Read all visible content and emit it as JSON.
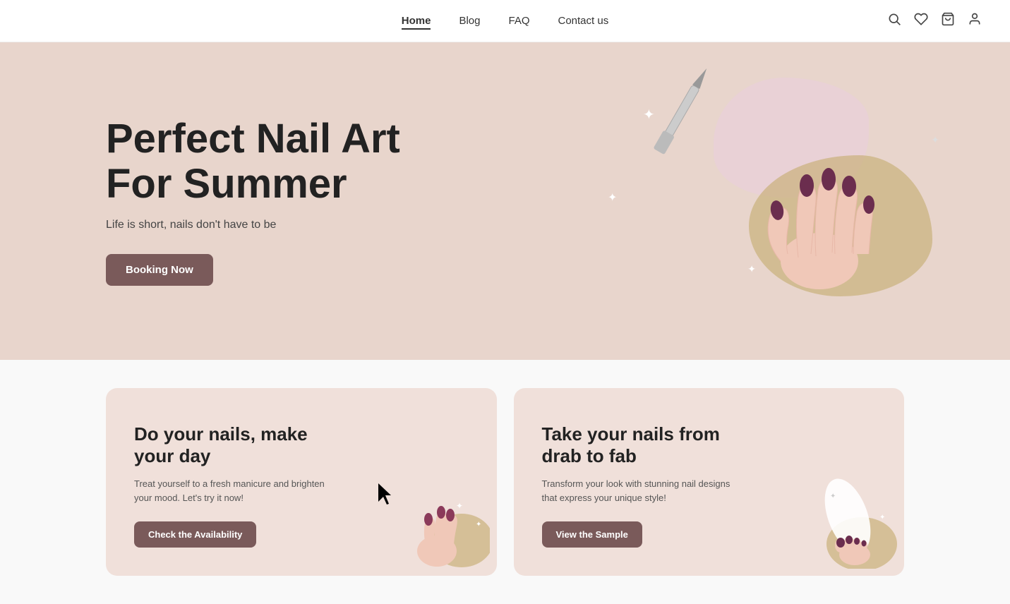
{
  "nav": {
    "links": [
      {
        "id": "home",
        "label": "Home",
        "active": true
      },
      {
        "id": "blog",
        "label": "Blog",
        "active": false
      },
      {
        "id": "faq",
        "label": "FAQ",
        "active": false
      },
      {
        "id": "contact",
        "label": "Contact us",
        "active": false
      }
    ],
    "icons": {
      "search": "🔍",
      "heart": "♡",
      "bag": "🛍",
      "user": "👤"
    }
  },
  "hero": {
    "title": "Perfect Nail Art For Summer",
    "subtitle": "Life is short, nails don't have to be",
    "cta": "Booking Now",
    "bg_color": "#e8d5cc"
  },
  "cards": [
    {
      "id": "card-1",
      "title": "Do your nails, make your day",
      "desc": "Treat yourself to a fresh manicure and brighten your mood. Let's try it now!",
      "cta": "Check the Availability"
    },
    {
      "id": "card-2",
      "title": "Take your nails from drab to fab",
      "desc": "Transform your look with stunning nail designs that express your unique style!",
      "cta": "View the Sample"
    }
  ]
}
